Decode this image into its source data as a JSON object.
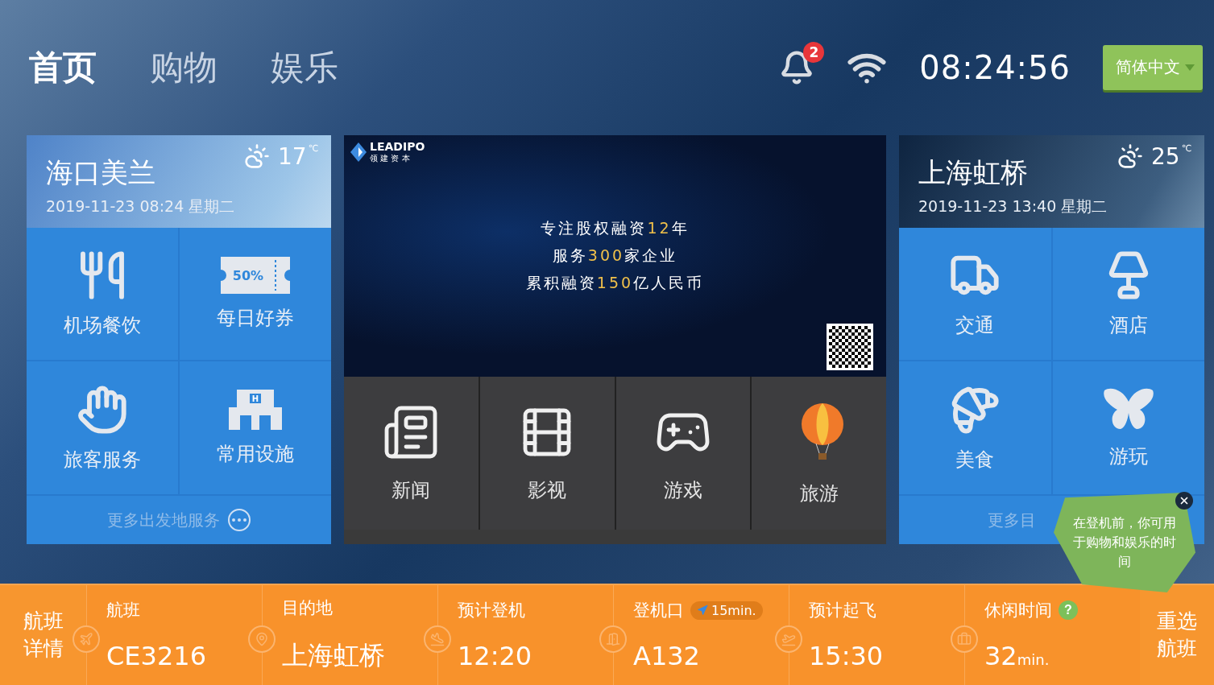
{
  "nav": {
    "tabs": [
      {
        "label": "首页",
        "selected": true
      },
      {
        "label": "购物",
        "selected": false
      },
      {
        "label": "娱乐",
        "selected": false
      }
    ]
  },
  "status": {
    "notification_count": "2",
    "time": "08:24:56",
    "language": "简体中文"
  },
  "departure": {
    "city": "海口美兰",
    "datetime": "2019-11-23 08:24 星期二",
    "temp": "17",
    "unit": "℃",
    "tiles": [
      {
        "kind": "dining",
        "label": "机场餐饮"
      },
      {
        "kind": "coupon",
        "label": "每日好券",
        "icon_text": "50%"
      },
      {
        "kind": "service",
        "label": "旅客服务"
      },
      {
        "kind": "facility",
        "label": "常用设施",
        "icon_text": "H"
      }
    ],
    "more": "更多出发地服务"
  },
  "banner": {
    "brand": "LEADIPO",
    "brand_sub": "领 建 资 本",
    "lines": [
      [
        {
          "text": "专注股权融资",
          "highlight": false
        },
        {
          "text": "12",
          "highlight": true
        },
        {
          "text": "年",
          "highlight": false
        }
      ],
      [
        {
          "text": "服务",
          "highlight": false
        },
        {
          "text": "300",
          "highlight": true
        },
        {
          "text": "家企业",
          "highlight": false
        }
      ],
      [
        {
          "text": "累积融资",
          "highlight": false
        },
        {
          "text": "150",
          "highlight": true
        },
        {
          "text": "亿人民币",
          "highlight": false
        }
      ]
    ]
  },
  "media": [
    {
      "kind": "news",
      "label": "新闻"
    },
    {
      "kind": "video",
      "label": "影视"
    },
    {
      "kind": "game",
      "label": "游戏"
    },
    {
      "kind": "travel",
      "label": "旅游"
    }
  ],
  "arrival": {
    "city": "上海虹桥",
    "datetime": "2019-11-23 13:40 星期二",
    "temp": "25",
    "unit": "℃",
    "tiles": [
      {
        "kind": "transport",
        "label": "交通"
      },
      {
        "kind": "hotel",
        "label": "酒店"
      },
      {
        "kind": "food",
        "label": "美食"
      },
      {
        "kind": "fun",
        "label": "游玩"
      }
    ],
    "more": "更多目"
  },
  "tooltip": {
    "text": "在登机前，你可用于购物和娱乐的时间"
  },
  "flight_bar": {
    "details": "航班详情",
    "reselect": "重选航班",
    "fields": [
      {
        "kind": "flight",
        "label": "航班",
        "value": "CE3216"
      },
      {
        "kind": "destination",
        "label": "目的地",
        "value": "上海虹桥"
      },
      {
        "kind": "boarding",
        "label": "预计登机",
        "value": "12:20"
      },
      {
        "kind": "gate",
        "label": "登机口",
        "value": "A132",
        "badge": "15min."
      },
      {
        "kind": "departure",
        "label": "预计起飞",
        "value": "15:30"
      },
      {
        "kind": "leisure",
        "label": "休闲时间",
        "value": "32",
        "unit": "min.",
        "help": "?"
      }
    ]
  }
}
